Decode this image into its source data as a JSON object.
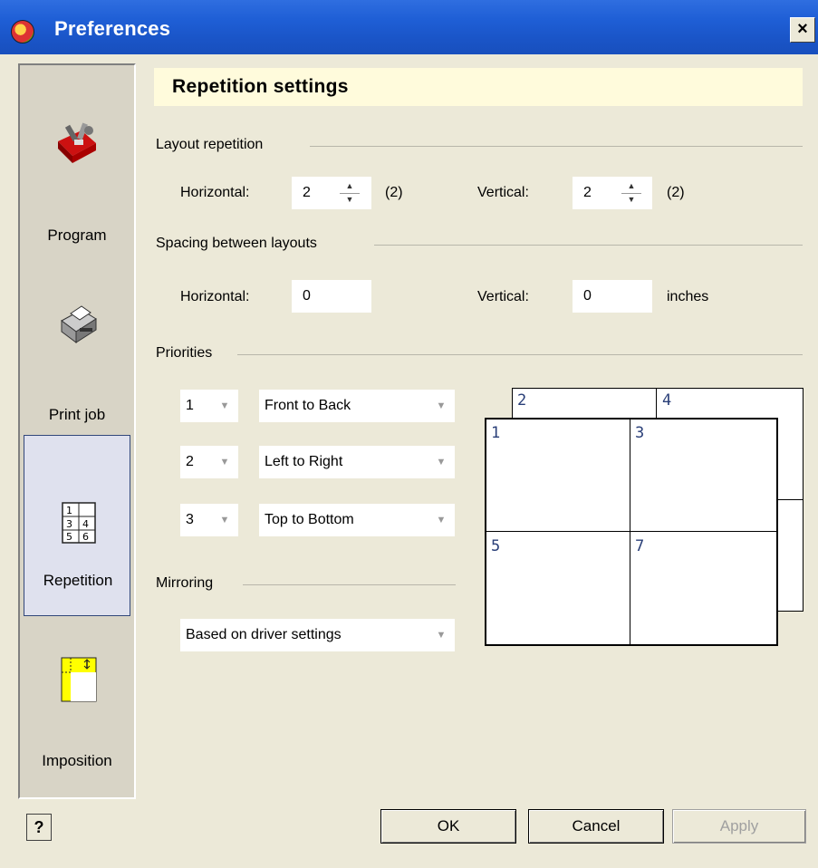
{
  "window": {
    "title": "Preferences",
    "close_label": "×"
  },
  "sidebar": {
    "items": [
      {
        "label": "Program",
        "icon": "toolbox-icon"
      },
      {
        "label": "Print job",
        "icon": "printer-icon"
      },
      {
        "label": "Repetition",
        "icon": "repetition-icon",
        "active": true
      },
      {
        "label": "Imposition",
        "icon": "imposition-icon"
      }
    ]
  },
  "header": {
    "title": "Repetition settings"
  },
  "layout_repetition": {
    "title": "Layout repetition",
    "horizontal_label": "Horizontal:",
    "horizontal_value": "2",
    "horizontal_note": "(2)",
    "vertical_label": "Vertical:",
    "vertical_value": "2",
    "vertical_note": "(2)"
  },
  "spacing": {
    "title": "Spacing between layouts",
    "horizontal_label": "Horizontal:",
    "horizontal_value": "0",
    "vertical_label": "Vertical:",
    "vertical_value": "0",
    "unit": "inches"
  },
  "priorities": {
    "title": "Priorities",
    "rows": [
      {
        "rank": "1",
        "order": "Front to Back"
      },
      {
        "rank": "2",
        "order": "Left to Right"
      },
      {
        "rank": "3",
        "order": "Top to Bottom"
      }
    ]
  },
  "mirroring": {
    "title": "Mirroring",
    "value": "Based on driver settings"
  },
  "diagram": {
    "back_labels": [
      "2",
      "4"
    ],
    "front_labels": [
      "1",
      "3",
      "5",
      "7"
    ]
  },
  "buttons": {
    "help": "?",
    "ok": "OK",
    "cancel": "Cancel",
    "apply": "Apply"
  }
}
